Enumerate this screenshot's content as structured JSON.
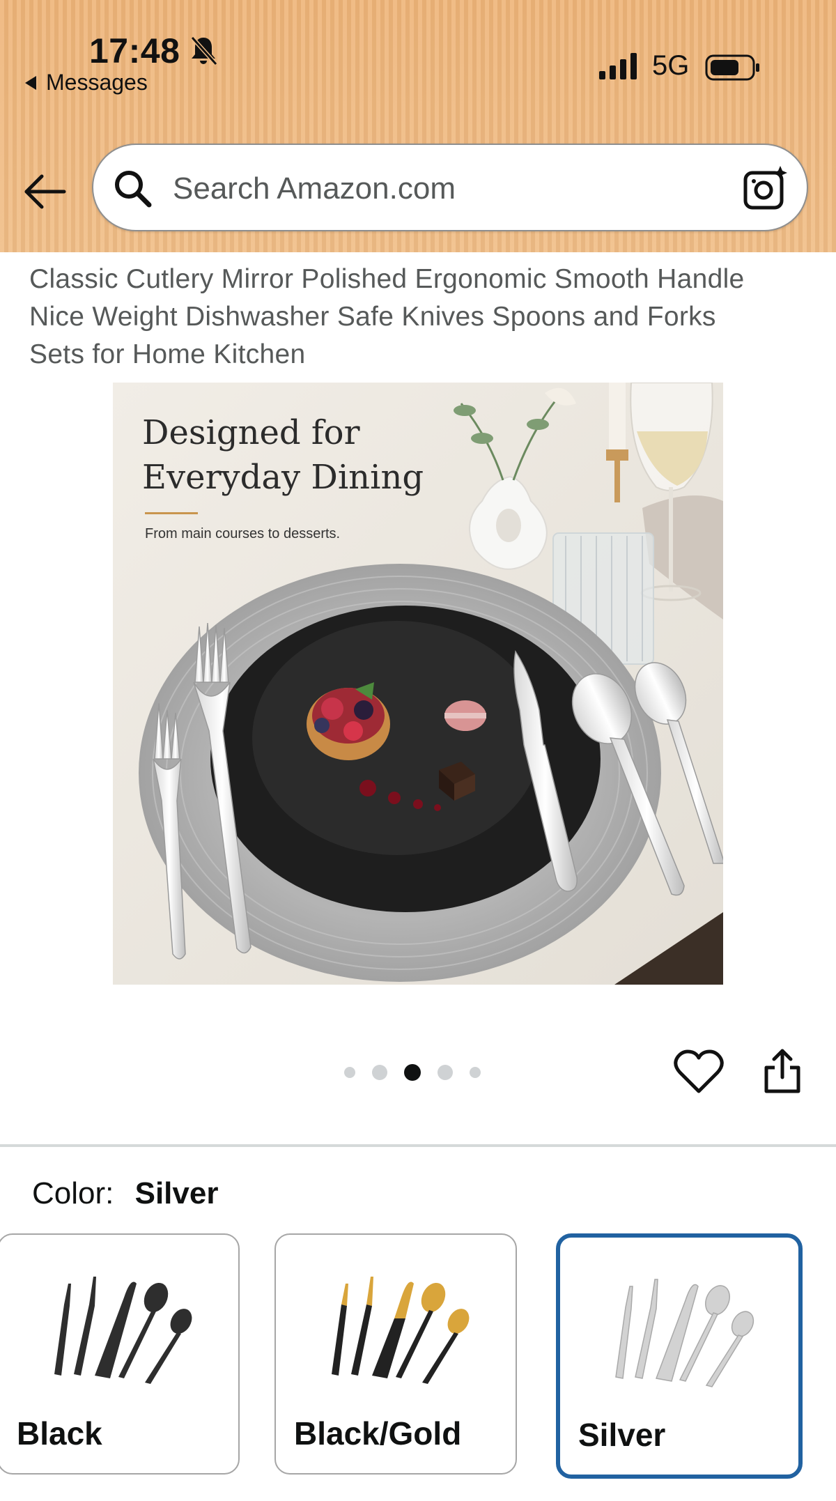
{
  "status_bar": {
    "time": "17:48",
    "back_app": "Messages",
    "network": "5G"
  },
  "search": {
    "placeholder": "Search Amazon.com"
  },
  "product": {
    "title_lines": [
      "Classic Cutlery Mirror Polished Ergonomic Smooth Handle",
      "Nice Weight Dishwasher Safe Knives Spoons and Forks",
      "Sets for Home Kitchen"
    ],
    "image": {
      "heading_line1": "Designed for",
      "heading_line2": "Everyday Dining",
      "subheading": "From main courses to desserts."
    },
    "carousel": {
      "total_dots": 5,
      "active_index": 2
    }
  },
  "color": {
    "label": "Color:",
    "selected": "Silver",
    "options": [
      {
        "label": "Black",
        "tone": "#2e2e2e",
        "accent": "#2e2e2e"
      },
      {
        "label": "Black/Gold",
        "tone": "#222222",
        "accent": "#d9a53b"
      },
      {
        "label": "Silver",
        "tone": "#c9c9c9",
        "accent": "#c9c9c9"
      }
    ]
  },
  "icons": {
    "back": "back-arrow-icon",
    "search": "search-icon",
    "camera": "camera-icon",
    "wishlist": "heart-icon",
    "share": "share-icon",
    "notifications_muted": "bell-off-icon"
  },
  "colors": {
    "header_bg": "#eeb478",
    "selected_border": "#2162a1",
    "dot_active": "#0f1111",
    "dot_inactive": "#cfd2d4"
  }
}
